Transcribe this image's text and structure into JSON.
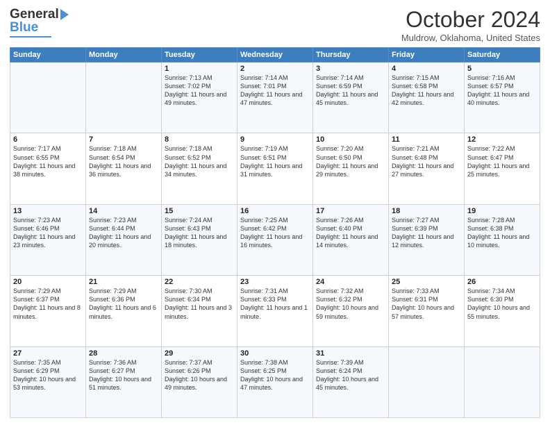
{
  "logo": {
    "line1": "General",
    "line2": "Blue"
  },
  "title": "October 2024",
  "location": "Muldrow, Oklahoma, United States",
  "days_header": [
    "Sunday",
    "Monday",
    "Tuesday",
    "Wednesday",
    "Thursday",
    "Friday",
    "Saturday"
  ],
  "weeks": [
    [
      {
        "day": "",
        "detail": ""
      },
      {
        "day": "",
        "detail": ""
      },
      {
        "day": "1",
        "detail": "Sunrise: 7:13 AM\nSunset: 7:02 PM\nDaylight: 11 hours and 49 minutes."
      },
      {
        "day": "2",
        "detail": "Sunrise: 7:14 AM\nSunset: 7:01 PM\nDaylight: 11 hours and 47 minutes."
      },
      {
        "day": "3",
        "detail": "Sunrise: 7:14 AM\nSunset: 6:59 PM\nDaylight: 11 hours and 45 minutes."
      },
      {
        "day": "4",
        "detail": "Sunrise: 7:15 AM\nSunset: 6:58 PM\nDaylight: 11 hours and 42 minutes."
      },
      {
        "day": "5",
        "detail": "Sunrise: 7:16 AM\nSunset: 6:57 PM\nDaylight: 11 hours and 40 minutes."
      }
    ],
    [
      {
        "day": "6",
        "detail": "Sunrise: 7:17 AM\nSunset: 6:55 PM\nDaylight: 11 hours and 38 minutes."
      },
      {
        "day": "7",
        "detail": "Sunrise: 7:18 AM\nSunset: 6:54 PM\nDaylight: 11 hours and 36 minutes."
      },
      {
        "day": "8",
        "detail": "Sunrise: 7:18 AM\nSunset: 6:52 PM\nDaylight: 11 hours and 34 minutes."
      },
      {
        "day": "9",
        "detail": "Sunrise: 7:19 AM\nSunset: 6:51 PM\nDaylight: 11 hours and 31 minutes."
      },
      {
        "day": "10",
        "detail": "Sunrise: 7:20 AM\nSunset: 6:50 PM\nDaylight: 11 hours and 29 minutes."
      },
      {
        "day": "11",
        "detail": "Sunrise: 7:21 AM\nSunset: 6:48 PM\nDaylight: 11 hours and 27 minutes."
      },
      {
        "day": "12",
        "detail": "Sunrise: 7:22 AM\nSunset: 6:47 PM\nDaylight: 11 hours and 25 minutes."
      }
    ],
    [
      {
        "day": "13",
        "detail": "Sunrise: 7:23 AM\nSunset: 6:46 PM\nDaylight: 11 hours and 23 minutes."
      },
      {
        "day": "14",
        "detail": "Sunrise: 7:23 AM\nSunset: 6:44 PM\nDaylight: 11 hours and 20 minutes."
      },
      {
        "day": "15",
        "detail": "Sunrise: 7:24 AM\nSunset: 6:43 PM\nDaylight: 11 hours and 18 minutes."
      },
      {
        "day": "16",
        "detail": "Sunrise: 7:25 AM\nSunset: 6:42 PM\nDaylight: 11 hours and 16 minutes."
      },
      {
        "day": "17",
        "detail": "Sunrise: 7:26 AM\nSunset: 6:40 PM\nDaylight: 11 hours and 14 minutes."
      },
      {
        "day": "18",
        "detail": "Sunrise: 7:27 AM\nSunset: 6:39 PM\nDaylight: 11 hours and 12 minutes."
      },
      {
        "day": "19",
        "detail": "Sunrise: 7:28 AM\nSunset: 6:38 PM\nDaylight: 11 hours and 10 minutes."
      }
    ],
    [
      {
        "day": "20",
        "detail": "Sunrise: 7:29 AM\nSunset: 6:37 PM\nDaylight: 11 hours and 8 minutes."
      },
      {
        "day": "21",
        "detail": "Sunrise: 7:29 AM\nSunset: 6:36 PM\nDaylight: 11 hours and 6 minutes."
      },
      {
        "day": "22",
        "detail": "Sunrise: 7:30 AM\nSunset: 6:34 PM\nDaylight: 11 hours and 3 minutes."
      },
      {
        "day": "23",
        "detail": "Sunrise: 7:31 AM\nSunset: 6:33 PM\nDaylight: 11 hours and 1 minute."
      },
      {
        "day": "24",
        "detail": "Sunrise: 7:32 AM\nSunset: 6:32 PM\nDaylight: 10 hours and 59 minutes."
      },
      {
        "day": "25",
        "detail": "Sunrise: 7:33 AM\nSunset: 6:31 PM\nDaylight: 10 hours and 57 minutes."
      },
      {
        "day": "26",
        "detail": "Sunrise: 7:34 AM\nSunset: 6:30 PM\nDaylight: 10 hours and 55 minutes."
      }
    ],
    [
      {
        "day": "27",
        "detail": "Sunrise: 7:35 AM\nSunset: 6:29 PM\nDaylight: 10 hours and 53 minutes."
      },
      {
        "day": "28",
        "detail": "Sunrise: 7:36 AM\nSunset: 6:27 PM\nDaylight: 10 hours and 51 minutes."
      },
      {
        "day": "29",
        "detail": "Sunrise: 7:37 AM\nSunset: 6:26 PM\nDaylight: 10 hours and 49 minutes."
      },
      {
        "day": "30",
        "detail": "Sunrise: 7:38 AM\nSunset: 6:25 PM\nDaylight: 10 hours and 47 minutes."
      },
      {
        "day": "31",
        "detail": "Sunrise: 7:39 AM\nSunset: 6:24 PM\nDaylight: 10 hours and 45 minutes."
      },
      {
        "day": "",
        "detail": ""
      },
      {
        "day": "",
        "detail": ""
      }
    ]
  ]
}
